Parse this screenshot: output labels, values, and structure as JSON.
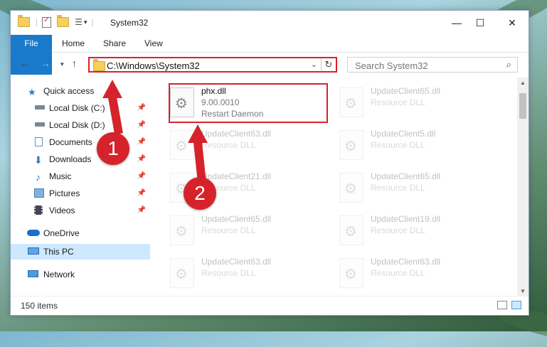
{
  "window": {
    "title": "System32",
    "controls": {
      "minimize": "—",
      "maximize": "☐",
      "close": "✕"
    }
  },
  "ribbon": {
    "tabs": [
      "File",
      "Home",
      "Share",
      "View"
    ]
  },
  "address_bar": {
    "path": "C:\\Windows\\System32"
  },
  "search": {
    "placeholder": "Search System32"
  },
  "sidebar": {
    "items": [
      {
        "label": "Quick access",
        "icon": "star-icon",
        "pinned": false
      },
      {
        "label": "Local Disk (C:)",
        "icon": "drive-icon",
        "pinned": true
      },
      {
        "label": "Local Disk (D:)",
        "icon": "drive-icon",
        "pinned": true
      },
      {
        "label": "Documents",
        "icon": "documents-icon",
        "pinned": true
      },
      {
        "label": "Downloads",
        "icon": "download-icon",
        "pinned": true
      },
      {
        "label": "Music",
        "icon": "music-icon",
        "pinned": true
      },
      {
        "label": "Pictures",
        "icon": "pictures-icon",
        "pinned": true
      },
      {
        "label": "Videos",
        "icon": "videos-icon",
        "pinned": true
      },
      {
        "label": "OneDrive",
        "icon": "cloud-icon",
        "pinned": false
      },
      {
        "label": "This PC",
        "icon": "computer-icon",
        "pinned": false,
        "selected": true
      },
      {
        "label": "Network",
        "icon": "network-icon",
        "pinned": false
      }
    ]
  },
  "files": {
    "left_column": [
      {
        "name": "phx.dll",
        "line2": "9.00.0010",
        "line3": "Restart Daemon",
        "highlighted": true
      },
      {
        "name": "UpdateClient63.dll",
        "line2": "Resource DLL"
      },
      {
        "name": "UpdateClient21.dll",
        "line2": "Resource DLL"
      },
      {
        "name": "UpdateClient65.dll",
        "line2": "Resource DLL"
      },
      {
        "name": "UpdateClient63.dll",
        "line2": "Resource DLL"
      }
    ],
    "right_column": [
      {
        "name": "UpdateClient65.dll",
        "line2": "Resource DLL"
      },
      {
        "name": "UpdateClient5.dll",
        "line2": "Resource DLL"
      },
      {
        "name": "UpdateClient65.dll",
        "line2": "Resource DLL"
      },
      {
        "name": "UpdateClient19.dll",
        "line2": "Resource DLL"
      },
      {
        "name": "UpdateClient63.dll",
        "line2": "Resource DLL"
      }
    ]
  },
  "status_bar": {
    "item_count": "150 items"
  },
  "annotations": {
    "step1": "1",
    "step2": "2",
    "color": "#d6232b"
  },
  "colors": {
    "accent": "#1979ca",
    "selected": "#cde8ff",
    "highlight": "#d6232b"
  }
}
